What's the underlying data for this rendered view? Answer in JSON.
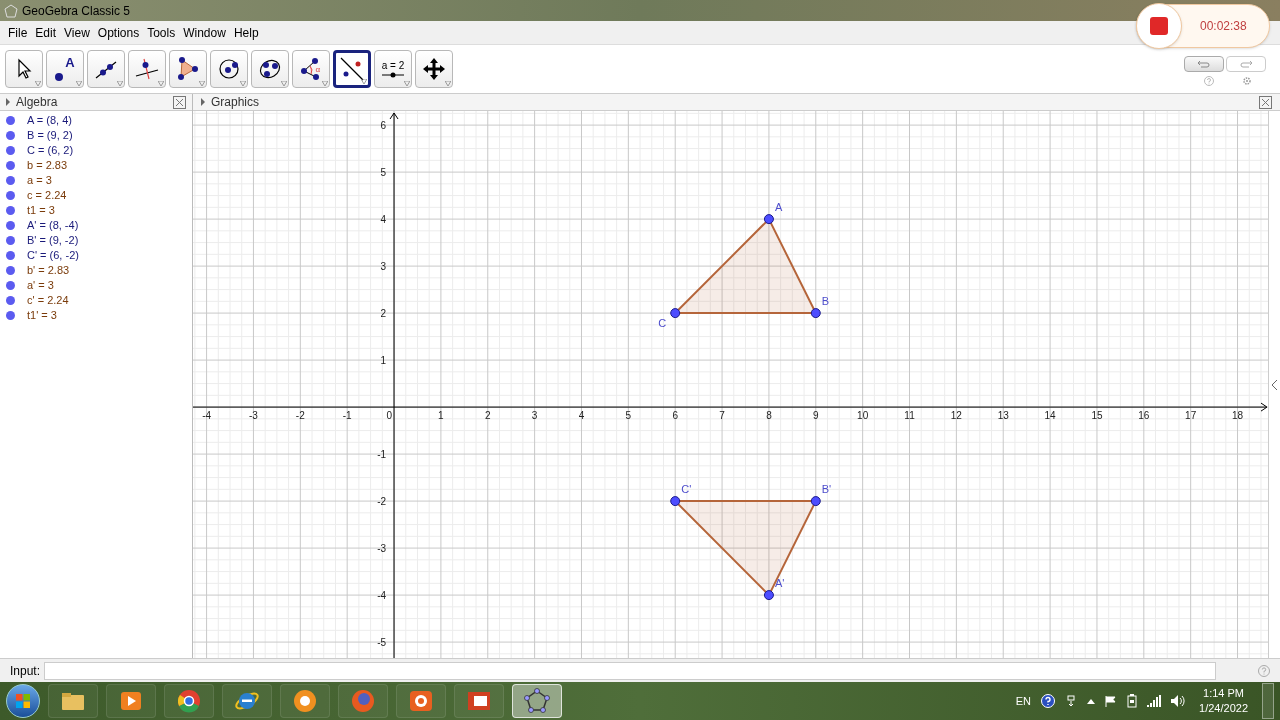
{
  "window": {
    "title": "GeoGebra Classic 5"
  },
  "menu": [
    "File",
    "Edit",
    "View",
    "Options",
    "Tools",
    "Window",
    "Help"
  ],
  "tools": [
    {
      "kind": "move",
      "selected": false
    },
    {
      "kind": "point",
      "selected": false,
      "label": "A"
    },
    {
      "kind": "line",
      "selected": false
    },
    {
      "kind": "perpendicular",
      "selected": false
    },
    {
      "kind": "polygon",
      "selected": false
    },
    {
      "kind": "circle",
      "selected": false
    },
    {
      "kind": "ellipse",
      "selected": false
    },
    {
      "kind": "angle",
      "selected": false,
      "label": "α"
    },
    {
      "kind": "reflect",
      "selected": true
    },
    {
      "kind": "slider",
      "selected": false,
      "label": "a = 2"
    },
    {
      "kind": "move_view",
      "selected": false
    }
  ],
  "recorder": {
    "time": "00:02:38"
  },
  "algebra": {
    "title": "Algebra",
    "items": [
      {
        "kind": "point",
        "text": "A = (8, 4)"
      },
      {
        "kind": "point",
        "text": "B = (9, 2)"
      },
      {
        "kind": "point",
        "text": "C = (6, 2)"
      },
      {
        "kind": "number",
        "text": "b = 2.83"
      },
      {
        "kind": "number",
        "text": "a = 3"
      },
      {
        "kind": "number",
        "text": "c = 2.24"
      },
      {
        "kind": "number",
        "text": "t1 = 3"
      },
      {
        "kind": "point",
        "text": "A' = (8, -4)"
      },
      {
        "kind": "point",
        "text": "B' = (9, -2)"
      },
      {
        "kind": "point",
        "text": "C' = (6, -2)"
      },
      {
        "kind": "number",
        "text": "b' = 2.83"
      },
      {
        "kind": "number",
        "text": "a' = 3"
      },
      {
        "kind": "number",
        "text": "c' = 2.24"
      },
      {
        "kind": "number",
        "text": "t1' = 3"
      }
    ]
  },
  "graphics": {
    "title": "Graphics",
    "chart_data": {
      "type": "scatter",
      "xlim": [
        -4.29,
        18.65
      ],
      "ylim": [
        -5.36,
        6.3
      ],
      "xticks": [
        -4,
        -3,
        -2,
        -1,
        0,
        1,
        2,
        3,
        4,
        5,
        6,
        7,
        8,
        9,
        10,
        11,
        12,
        13,
        14,
        15,
        16,
        17,
        18
      ],
      "grid": true,
      "yticks": [
        -5,
        -4,
        -3,
        -2,
        -1,
        1,
        2,
        3,
        4,
        5,
        6
      ],
      "series": [
        {
          "color": "#4d4dff",
          "x": [
            8,
            9,
            6
          ],
          "values": [
            4,
            2,
            2
          ]
        },
        {
          "color": "#4d4dff",
          "x": [
            6,
            9,
            8
          ],
          "values": [
            -2,
            -2,
            -4
          ]
        }
      ],
      "annotations": [
        "A",
        "B",
        "C",
        "C'",
        "B'",
        "A'"
      ]
    }
  },
  "input": {
    "label": "Input:"
  },
  "taskbar": {
    "apps": [
      {
        "kind": "folder",
        "selected": false
      },
      {
        "kind": "media",
        "selected": false
      },
      {
        "kind": "chrome",
        "selected": false
      },
      {
        "kind": "ie",
        "selected": false
      },
      {
        "kind": "orange",
        "selected": false
      },
      {
        "kind": "firefox",
        "selected": false
      },
      {
        "kind": "recorder",
        "selected": false
      },
      {
        "kind": "slides",
        "selected": false
      },
      {
        "kind": "geogebra",
        "selected": true
      }
    ],
    "language": "EN",
    "time": "1:14 PM",
    "date": "1/24/2022"
  }
}
